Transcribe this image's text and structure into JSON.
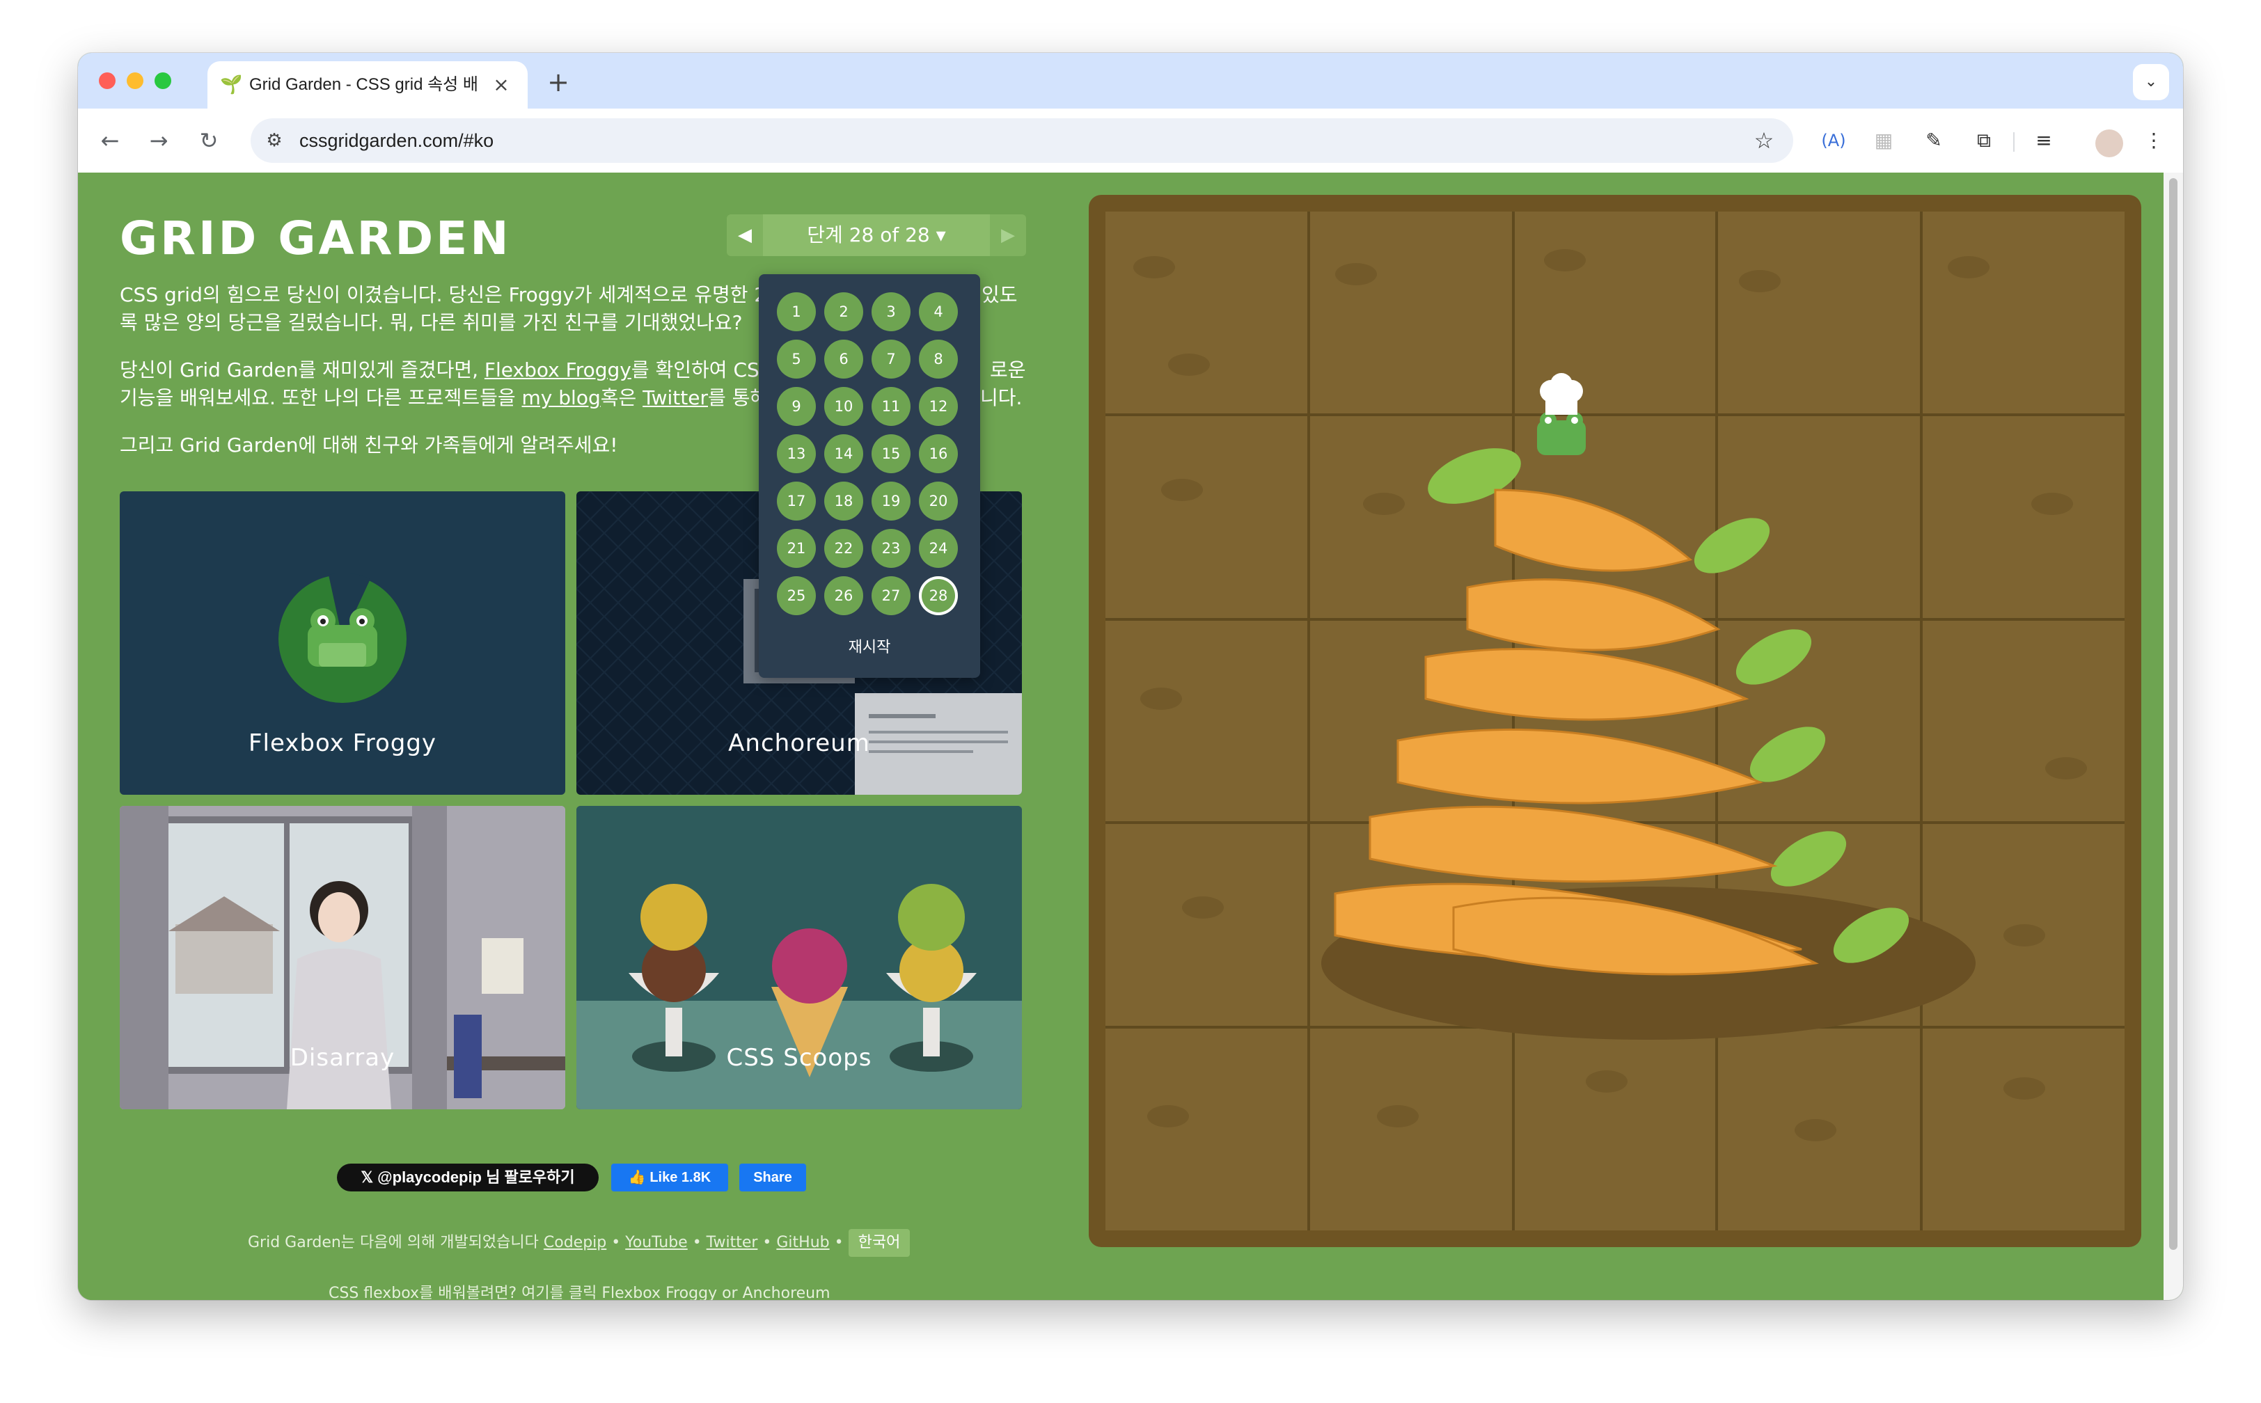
{
  "browser": {
    "tab_title": "Grid Garden - CSS grid 속성 배",
    "tab_favicon": "🌱",
    "new_tab": "+",
    "url": "cssgridgarden.com/#ko"
  },
  "game": {
    "title": "GRID GARDEN",
    "nav_prev": "◀",
    "nav_next": "▶",
    "level_indicator": "단계 28 of 28 ▾",
    "para1_line1": "CSS grid의 힘으로 당신이 이겼습니다. 당신은 Froggy가 세계적으로 유명한 20",
    "para1_line1_end": "있도",
    "para1_line2": "록 많은 양의 당근을 길렀습니다. 뭐, 다른 취미를 가진 친구를 기대했었나요?",
    "para2_pre": "당신이 Grid Garden를 재미있게 즐겼다면, ",
    "para2_link1": "Flexbox Froggy",
    "para2_mid": "를 확인하여 CSS ",
    "para2_end1": "로운",
    "para2_line2_pre": "기능을 배워보세요. 또한 나의 다른 프로젝트들을 ",
    "para2_link2": "my blog",
    "para2_line2_mid": "혹은 ",
    "para2_link3": "Twitter",
    "para2_line2_post": "를 통해",
    "para2_end2": "니다.",
    "para3": "그리고 Grid Garden에 대해 친구와 가족들에게 알려주세요!",
    "cards": [
      {
        "label": "Flexbox Froggy"
      },
      {
        "label": "Anchoreum"
      },
      {
        "label": "Disarray"
      },
      {
        "label": "CSS Scoops"
      }
    ],
    "levels": [
      "1",
      "2",
      "3",
      "4",
      "5",
      "6",
      "7",
      "8",
      "9",
      "10",
      "11",
      "12",
      "13",
      "14",
      "15",
      "16",
      "17",
      "18",
      "19",
      "20",
      "21",
      "22",
      "23",
      "24",
      "25",
      "26",
      "27",
      "28"
    ],
    "current_level": "28",
    "reset_label": "재시작",
    "x_follow": "𝕏 @playcodepip 님 팔로우하기",
    "fb_like": "👍 Like 1.8K",
    "fb_share": "Share",
    "footer_prefix": "Grid Garden는 다음에 의해 개발되었습니다 ",
    "footer_links": [
      "Codepip",
      "YouTube",
      "Twitter",
      "GitHub"
    ],
    "footer_sep": " • ",
    "language_button": "한국어",
    "footer_line2": "CSS flexbox를 배워볼려면? 여기를 클릭 Flexbox Froggy or Anchoreum"
  },
  "colors": {
    "page_bg": "#6ea451",
    "soil": "#7e6431",
    "soil_border": "#6e5423",
    "carrot": "#f0a540",
    "leaf": "#8bc34a",
    "dropdown_bg": "#2c3e50"
  }
}
